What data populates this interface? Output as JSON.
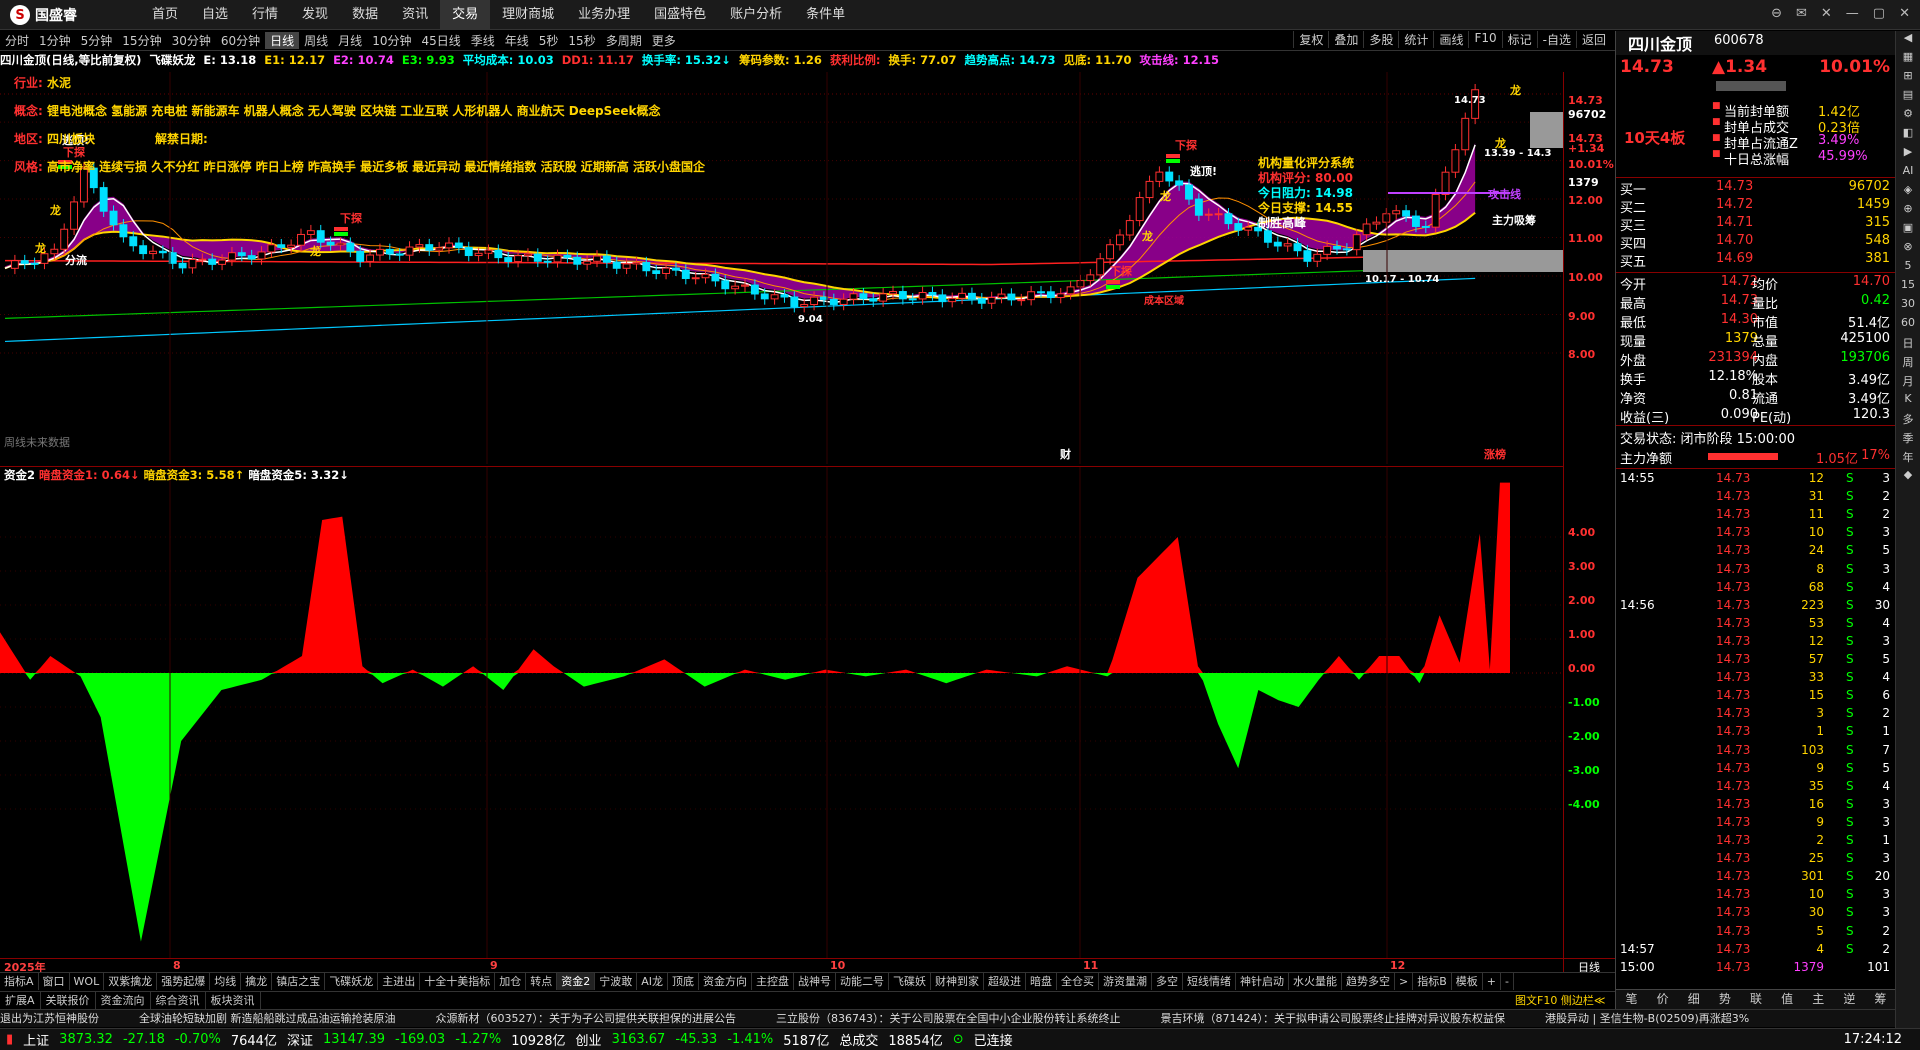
{
  "app": {
    "logo": "国盛睿",
    "menu": [
      "首页",
      "自选",
      "行情",
      "发现",
      "数据",
      "资讯",
      "交易",
      "理财商城",
      "业务办理",
      "国盛特色",
      "账户分析",
      "条件单"
    ],
    "menu_selected": "交易",
    "window_buttons": [
      "⊖",
      "✉",
      "✕",
      "—",
      "▢",
      "✕"
    ]
  },
  "periods": [
    "分时",
    "1分钟",
    "5分钟",
    "15分钟",
    "30分钟",
    "60分钟",
    "日线",
    "周线",
    "月线",
    "10分钟",
    "45日线",
    "季线",
    "年线",
    "5秒",
    "15秒",
    "多周期",
    "更多"
  ],
  "period_selected": "日线",
  "tools": [
    "复权",
    "叠加",
    "多股",
    "统计",
    "画线",
    "F10",
    "标记",
    "-自选",
    "返回"
  ],
  "kinfo": [
    [
      "wht",
      "四川金顶(日线,等比前复权)"
    ],
    [
      "wht",
      "飞碟妖龙"
    ],
    [
      "wht",
      "E: 13.18"
    ],
    [
      "yel",
      "E1: 12.17"
    ],
    [
      "mag",
      "E2: 10.74"
    ],
    [
      "grn",
      "E3: 9.93"
    ],
    [
      "cyan",
      "平均成本: 10.03"
    ],
    [
      "red",
      "DD1: 11.17"
    ],
    [
      "cyan",
      "换手率: 15.32↓"
    ],
    [
      "yel",
      "筹码参数: 1.26"
    ],
    [
      "red",
      "获利比例:"
    ],
    [
      "yel",
      "换手: 77.07"
    ],
    [
      "cyan",
      "趋势高点: 14.73"
    ],
    [
      "yel",
      "见底: 11.70"
    ],
    [
      "mag",
      "攻击线: 12.15"
    ]
  ],
  "info": {
    "industry_label": "行业:",
    "industry": "水泥",
    "concept_label": "概念:",
    "concepts": "锂电池概念 氢能源 充电桩 新能源车 机器人概念 无人驾驶 区块链 工业互联 人形机器人 商业航天 DeepSeek概念",
    "region_label": "地区:",
    "region": "四川板块",
    "unban_label": "解禁日期:",
    "style_label": "风格:",
    "styles": "高市净率 连续亏损 久不分红 昨日涨停 昨日上榜 昨高换手 最近多板 最近异动 最近情绪指数 活跃股 近期新高 活跃小盘国企",
    "quant_title": "机构量化评分系统",
    "quant_score": "机构评分: 80.00",
    "quant_resist": "今日阻力: 14.98",
    "quant_support": "今日支撑: 14.55",
    "quant_status": "制胜高峰",
    "no_future": "周线未来数据"
  },
  "chart_labels": {
    "xia_tan": "下探",
    "tao_ding": "逃顶!",
    "long": "龙",
    "fen_lv": "分流",
    "attack_line": "攻击线",
    "main_absorb": "主力吸筹",
    "range_box": "13.39 - 14.3",
    "range_low": "10.17 - 10.74",
    "low_mark": "9.04",
    "top_price": "14.73",
    "bottom_mark": "财",
    "zhangting": "涨榜",
    "cost_line": "成本区域"
  },
  "price_axis": [
    "14.73",
    "96702",
    "14.73",
    "+1.34",
    "10.01%",
    "1379",
    "12.00",
    "11.00",
    "10.00",
    "9.00",
    "8.00"
  ],
  "sub": {
    "title": "资金2",
    "a": "暗盘资金1: 0.64↓",
    "b": "暗盘资金3: 5.58↑",
    "c": "暗盘资金5: 3.32↓",
    "axis": [
      "4.00",
      "3.00",
      "2.00",
      "1.00",
      "0.00",
      "-1.00",
      "-2.00",
      "-3.00",
      "-4.00"
    ]
  },
  "dates": [
    "2025年",
    "8",
    "9",
    "10",
    "11",
    "12"
  ],
  "sub_axis_label": "日线",
  "tabs": [
    "指标A",
    "窗口",
    "WOL",
    "双紫擒龙",
    "强势起爆",
    "均线",
    "擒龙",
    "镇店之宝",
    "飞碟妖龙",
    "主进出",
    "十全十美指标",
    "加仓",
    "转点",
    "资金2",
    "宁波敢",
    "AI龙",
    "顶底",
    "资金方向",
    "主控盘",
    "战神号",
    "动能二号",
    "飞碟妖",
    "财神到家",
    "超级进",
    "暗盘",
    "全仓买",
    "游资量潮",
    "多空",
    "短线情绪",
    "神针启动",
    "水火量能",
    "趋势多空",
    ">",
    "指标B",
    "模板",
    "+",
    "-"
  ],
  "tab_selected": "资金2",
  "tabs2": [
    "扩展A",
    "关联报价",
    "资金流向",
    "综合资讯",
    "板块资讯"
  ],
  "tabs2_right": "图文F10 侧边栏≪",
  "ticker": [
    "退出为江苏恒神股份",
    "全球油轮短缺加剧 新造船船跳过成品油运输抢装原油",
    "众源新材（603527）：关于为子公司提供关联担保的进展公告",
    "三立股份（836743）：关于公司股票在全国中小企业股份转让系统终止",
    "景吉环境（871424）：关于拟申请公司股票终止挂牌对异议股东权益保",
    "港股异动 | 圣信生物-B(02509)再涨超3%"
  ],
  "status": {
    "sh": "上证",
    "sh_v": "3873.32",
    "sh_c": "-27.18",
    "sh_p": "-0.70%",
    "sh_a": "7644亿",
    "sz": "深证",
    "sz_v": "13147.39",
    "sz_c": "-169.03",
    "sz_p": "-1.27%",
    "sz_a": "10928亿",
    "cy": "创业",
    "cy_v": "3163.67",
    "cy_c": "-45.33",
    "cy_p": "-1.41%",
    "cy_a": "5187亿",
    "total": "总成交",
    "total_v": "18854亿",
    "conn": "已连接",
    "time": "17:24:12"
  },
  "quote": {
    "name": "四川金顶",
    "code": "600678",
    "price": "14.73",
    "change": "▲1.34",
    "pct": "10.01%",
    "boards": "10天4板",
    "seal_labels": [
      "当前封单额",
      "封单占成交",
      "封单占流通Z",
      "十日总涨幅"
    ],
    "seal_values": [
      "1.42亿",
      "0.23倍",
      "3.49%",
      "45.99%"
    ],
    "bids": [
      [
        "买一",
        "14.73",
        "96702"
      ],
      [
        "买二",
        "14.72",
        "1459"
      ],
      [
        "买三",
        "14.71",
        "315"
      ],
      [
        "买四",
        "14.70",
        "548"
      ],
      [
        "买五",
        "14.69",
        "381"
      ]
    ],
    "stats": [
      [
        "今开",
        "14.72",
        "均价",
        "14.70"
      ],
      [
        "最高",
        "14.73",
        "量比",
        "0.42"
      ],
      [
        "最低",
        "14.30",
        "市值",
        "51.4亿"
      ],
      [
        "现量",
        "1379",
        "总量",
        "425100"
      ],
      [
        "外盘",
        "231394",
        "内盘",
        "193706"
      ],
      [
        "换手",
        "12.18%",
        "股本",
        "3.49亿"
      ],
      [
        "净资",
        "0.81",
        "流通",
        "3.49亿"
      ],
      [
        "收益(三)",
        "0.090",
        "PE(动)",
        "120.3"
      ]
    ],
    "trade_status": "交易状态: 闭市阶段 15:00:00",
    "net_label": "主力净额",
    "net_value": "1.05亿",
    "net_pct": "17%",
    "ticks": [
      [
        "14:55",
        "14.73",
        "12",
        "S",
        "3"
      ],
      [
        "",
        "14.73",
        "31",
        "S",
        "2"
      ],
      [
        "",
        "14.73",
        "11",
        "S",
        "2"
      ],
      [
        "",
        "14.73",
        "10",
        "S",
        "3"
      ],
      [
        "",
        "14.73",
        "24",
        "S",
        "5"
      ],
      [
        "",
        "14.73",
        "8",
        "S",
        "3"
      ],
      [
        "",
        "14.73",
        "68",
        "S",
        "4"
      ],
      [
        "14:56",
        "14.73",
        "223",
        "S",
        "30"
      ],
      [
        "",
        "14.73",
        "53",
        "S",
        "4"
      ],
      [
        "",
        "14.73",
        "12",
        "S",
        "3"
      ],
      [
        "",
        "14.73",
        "57",
        "S",
        "5"
      ],
      [
        "",
        "14.73",
        "33",
        "S",
        "4"
      ],
      [
        "",
        "14.73",
        "15",
        "S",
        "6"
      ],
      [
        "",
        "14.73",
        "3",
        "S",
        "2"
      ],
      [
        "",
        "14.73",
        "1",
        "S",
        "1"
      ],
      [
        "",
        "14.73",
        "103",
        "S",
        "7"
      ],
      [
        "",
        "14.73",
        "9",
        "S",
        "5"
      ],
      [
        "",
        "14.73",
        "35",
        "S",
        "4"
      ],
      [
        "",
        "14.73",
        "16",
        "S",
        "3"
      ],
      [
        "",
        "14.73",
        "9",
        "S",
        "3"
      ],
      [
        "",
        "14.73",
        "2",
        "S",
        "1"
      ],
      [
        "",
        "14.73",
        "25",
        "S",
        "3"
      ],
      [
        "",
        "14.73",
        "301",
        "S",
        "20"
      ],
      [
        "",
        "14.73",
        "10",
        "S",
        "3"
      ],
      [
        "",
        "14.73",
        "30",
        "S",
        "3"
      ],
      [
        "",
        "14.73",
        "5",
        "S",
        "2"
      ],
      [
        "14:57",
        "14.73",
        "4",
        "S",
        "2"
      ],
      [
        "15:00",
        "14.73",
        "1379",
        "",
        "101"
      ]
    ],
    "bottom_tabs": [
      "笔",
      "价",
      "细",
      "势",
      "联",
      "值",
      "主",
      "逆",
      "筹"
    ]
  },
  "rside": [
    "◀",
    "▦",
    "⊞",
    "▤",
    "⚙",
    "◧",
    "▶",
    "AI",
    "◈",
    "⊕",
    "▣",
    "⊗",
    "5",
    "15",
    "30",
    "60",
    "日",
    "周",
    "月",
    "K",
    "多",
    "季",
    "年",
    "◆"
  ],
  "colors": {
    "up": "#ff3030",
    "down": "#00ff00",
    "bg": "#000000",
    "accent": "#ffd400"
  }
}
